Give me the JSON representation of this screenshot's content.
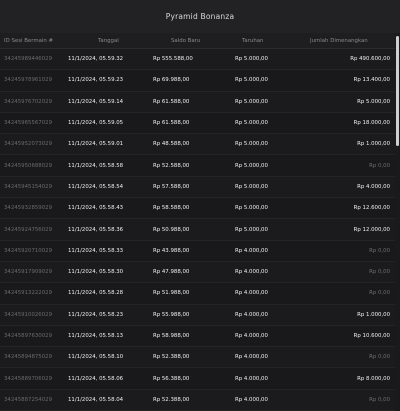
{
  "title": "Pyramid Bonanza",
  "columns": {
    "id": "ID Sesi Bermain #",
    "date": "Tanggal",
    "balance": "Saldo Baru",
    "bet": "Taruhan",
    "win": "Jumlah Dimenangkan"
  },
  "rows": [
    {
      "id": "34245989446029",
      "date": "11/1/2024, 05.59.32",
      "balance": "Rp 555.588,00",
      "bet": "Rp 5.000,00",
      "win": "Rp 490.600,00"
    },
    {
      "id": "34245978961029",
      "date": "11/1/2024, 05.59.23",
      "balance": "Rp 69.988,00",
      "bet": "Rp 5.000,00",
      "win": "Rp 13.400,00"
    },
    {
      "id": "34245976702029",
      "date": "11/1/2024, 05.59.14",
      "balance": "Rp 61.588,00",
      "bet": "Rp 5.000,00",
      "win": "Rp 5.000,00"
    },
    {
      "id": "34245965567029",
      "date": "11/1/2024, 05.59.05",
      "balance": "Rp 61.588,00",
      "bet": "Rp 5.000,00",
      "win": "Rp 18.000,00"
    },
    {
      "id": "34245952073029",
      "date": "11/1/2024, 05.59.01",
      "balance": "Rp 48.588,00",
      "bet": "Rp 5.000,00",
      "win": "Rp 1.000,00"
    },
    {
      "id": "34245950688029",
      "date": "11/1/2024, 05.58.58",
      "balance": "Rp 52.588,00",
      "bet": "Rp 5.000,00",
      "win": "Rp 0,00"
    },
    {
      "id": "34245945154029",
      "date": "11/1/2024, 05.58.54",
      "balance": "Rp 57.588,00",
      "bet": "Rp 5.000,00",
      "win": "Rp 4.000,00"
    },
    {
      "id": "34245932859029",
      "date": "11/1/2024, 05.58.43",
      "balance": "Rp 58.588,00",
      "bet": "Rp 5.000,00",
      "win": "Rp 12.600,00"
    },
    {
      "id": "34245924756029",
      "date": "11/1/2024, 05.58.36",
      "balance": "Rp 50.988,00",
      "bet": "Rp 5.000,00",
      "win": "Rp 12.000,00"
    },
    {
      "id": "34245920710029",
      "date": "11/1/2024, 05.58.33",
      "balance": "Rp 43.988,00",
      "bet": "Rp 4.000,00",
      "win": "Rp 0,00"
    },
    {
      "id": "34245917909029",
      "date": "11/1/2024, 05.58.30",
      "balance": "Rp 47.988,00",
      "bet": "Rp 4.000,00",
      "win": "Rp 0,00"
    },
    {
      "id": "34245913222029",
      "date": "11/1/2024, 05.58.28",
      "balance": "Rp 51.988,00",
      "bet": "Rp 4.000,00",
      "win": "Rp 0,00"
    },
    {
      "id": "34245910026029",
      "date": "11/1/2024, 05.58.23",
      "balance": "Rp 55.988,00",
      "bet": "Rp 4.000,00",
      "win": "Rp 1.000,00"
    },
    {
      "id": "34245897630029",
      "date": "11/1/2024, 05.58.13",
      "balance": "Rp 58.988,00",
      "bet": "Rp 4.000,00",
      "win": "Rp 10.600,00"
    },
    {
      "id": "34245894875029",
      "date": "11/1/2024, 05.58.10",
      "balance": "Rp 52.388,00",
      "bet": "Rp 4.000,00",
      "win": "Rp 0,00"
    },
    {
      "id": "34245889706029",
      "date": "11/1/2024, 05.58.06",
      "balance": "Rp 56.388,00",
      "bet": "Rp 4.000,00",
      "win": "Rp 8.000,00"
    },
    {
      "id": "34245887254029",
      "date": "11/1/2024, 05.58.04",
      "balance": "Rp 52.388,00",
      "bet": "Rp 4.000,00",
      "win": "Rp 0,00"
    }
  ]
}
